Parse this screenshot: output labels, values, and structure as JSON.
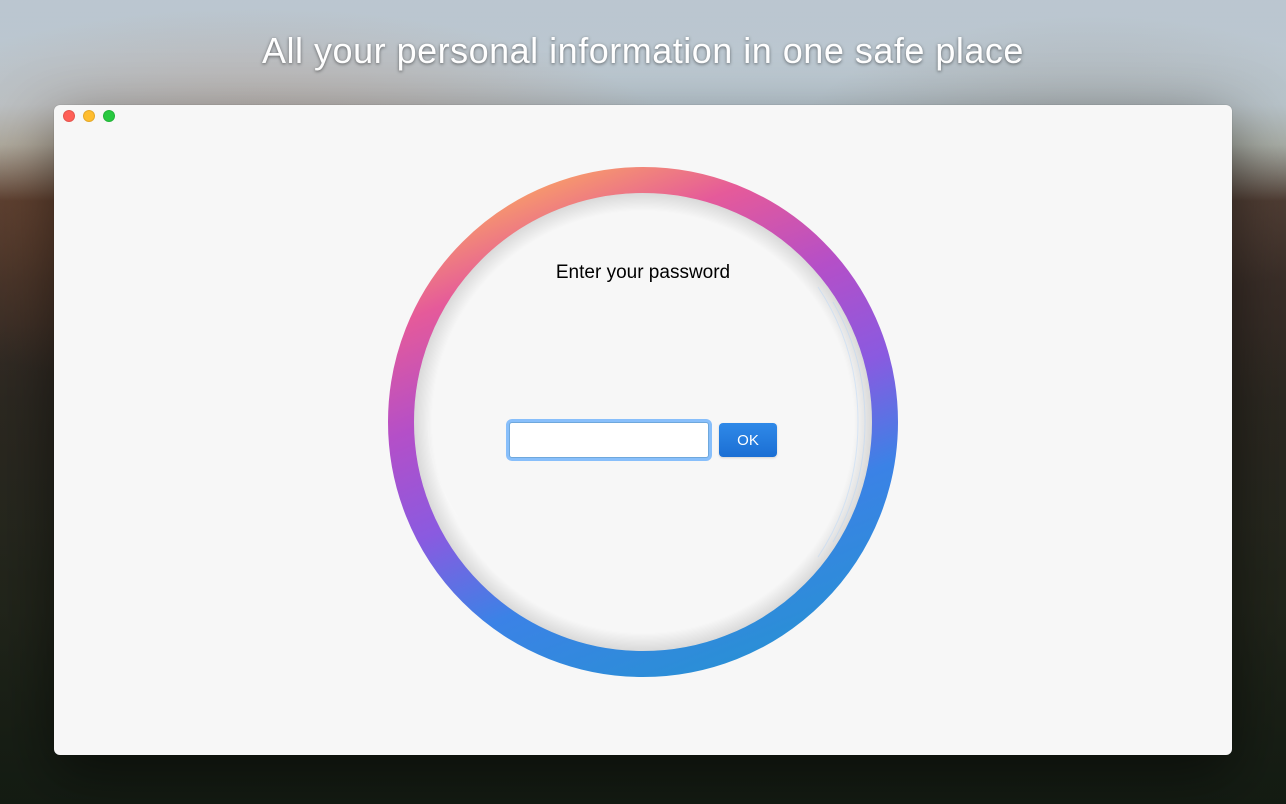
{
  "headline": "All your personal information in one safe place",
  "window": {
    "traffic": {
      "close_name": "close-icon",
      "min_name": "minimize-icon",
      "max_name": "maximize-icon"
    },
    "prompt": "Enter your password",
    "password_value": "",
    "ok_label": "OK"
  },
  "ring_gradient_stops": [
    {
      "offset": "0%",
      "color": "#f79a6b"
    },
    {
      "offset": "15%",
      "color": "#e55a9a"
    },
    {
      "offset": "35%",
      "color": "#b44fc8"
    },
    {
      "offset": "55%",
      "color": "#8a5ae0"
    },
    {
      "offset": "75%",
      "color": "#3b82e6"
    },
    {
      "offset": "100%",
      "color": "#2a8fd6"
    }
  ]
}
